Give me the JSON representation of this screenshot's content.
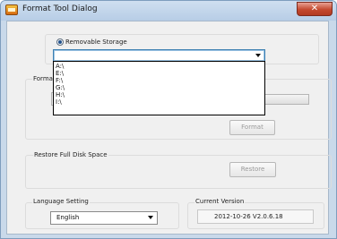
{
  "window": {
    "title": "Format Tool Dialog",
    "close_symbol": "✕"
  },
  "storage": {
    "radio_label": "Removable Storage",
    "drive_options": [
      "A:\\",
      "E:\\",
      "F:\\",
      "G:\\",
      "H:\\",
      "I:\\"
    ]
  },
  "format": {
    "group_label_partial": "Forma",
    "button_label": "Format"
  },
  "restore": {
    "group_label": "Restore Full Disk Space",
    "button_label": "Restore"
  },
  "language": {
    "group_label": "Language Setting",
    "selected": "English"
  },
  "version": {
    "group_label": "Current Version",
    "value": "2012-10-26 V2.0.6.18"
  }
}
